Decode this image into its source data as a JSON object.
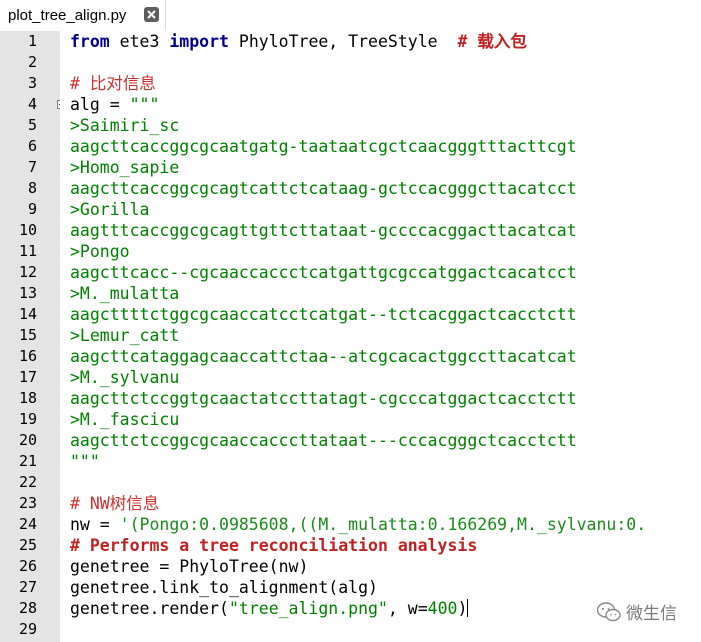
{
  "tab": {
    "filename": "plot_tree_align.py",
    "close_icon": "close-icon"
  },
  "lines": [
    {
      "n": "1"
    },
    {
      "n": "2"
    },
    {
      "n": "3"
    },
    {
      "n": "4"
    },
    {
      "n": "5"
    },
    {
      "n": "6"
    },
    {
      "n": "7"
    },
    {
      "n": "8"
    },
    {
      "n": "9"
    },
    {
      "n": "10"
    },
    {
      "n": "11"
    },
    {
      "n": "12"
    },
    {
      "n": "13"
    },
    {
      "n": "14"
    },
    {
      "n": "15"
    },
    {
      "n": "16"
    },
    {
      "n": "17"
    },
    {
      "n": "18"
    },
    {
      "n": "19"
    },
    {
      "n": "20"
    },
    {
      "n": "21"
    },
    {
      "n": "22"
    },
    {
      "n": "23"
    },
    {
      "n": "24"
    },
    {
      "n": "25"
    },
    {
      "n": "26"
    },
    {
      "n": "27"
    },
    {
      "n": "28"
    },
    {
      "n": "29"
    }
  ],
  "code": {
    "l1_from": "from",
    "l1_mod": " ete3 ",
    "l1_import": "import",
    "l1_names": " PhyloTree, TreeStyle  ",
    "l1_comment": "# 载入包",
    "l3_comment": "# 比对信息",
    "l4_var": "alg = ",
    "l4_str": "\"\"\"",
    "l5": ">Saimiri_sc",
    "l6": "aagcttcaccggcgcaatgatg-taataatcgctcaacgggtttacttcgt",
    "l7": ">Homo_sapie",
    "l8": "aagcttcaccggcgcagtcattctcataag-gctccacgggcttacatcct",
    "l9": ">Gorilla",
    "l10": "aagtttcaccggcgcagttgttcttataat-gccccacggacttacatcat",
    "l11": ">Pongo",
    "l12": "aagcttcacc--cgcaaccaccctcatgattgcgccatggactcacatcct",
    "l13": ">M._mulatta",
    "l14": "aagcttttctggcgcaaccatcctcatgat--tctcacggactcacctctt",
    "l15": ">Lemur_catt",
    "l16": "aagcttcataggagcaaccattctaa--atcgcacactggccttacatcat",
    "l17": ">M._sylvanu",
    "l18": "aagcttctccggtgcaactatccttatagt-cgcccatggactcacctctt",
    "l19": ">M._fascicu",
    "l20": "aagcttctccggcgcaaccacccttataat---cccacgggctcacctctt",
    "l21": "\"\"\"",
    "l23_comment": "# NW树信息",
    "l24_var": "nw = ",
    "l24_str": "'(Pongo:0.0985608,((M._mulatta:0.166269,M._sylvanu:0.",
    "l25_comment": "# Performs a tree reconciliation analysis",
    "l26": "genetree = PhyloTree(nw)",
    "l27": "genetree.link_to_alignment(alg)",
    "l28_pre": "genetree.render(",
    "l28_str": "\"tree_align.png\"",
    "l28_mid": ", w=",
    "l28_num": "400",
    "l28_end": ")"
  },
  "watermark": {
    "text": "微生信",
    "icon": "wechat-icon"
  }
}
